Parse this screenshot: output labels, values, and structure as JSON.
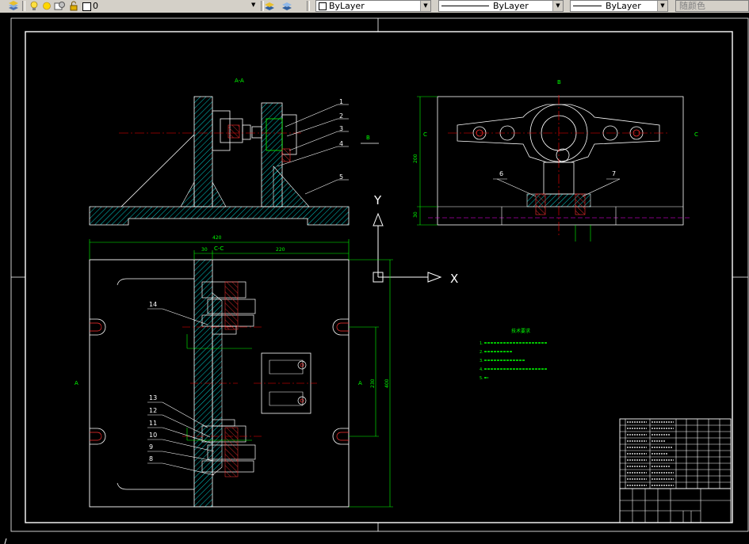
{
  "toolbar": {
    "layer_value": "0",
    "color_value": "ByLayer",
    "linetype_value": "ByLayer",
    "lineweight_value": "ByLayer",
    "plotstyle_value": "随颜色"
  },
  "drawing": {
    "view_aa": "A-A",
    "view_bb": "B",
    "view_cc": "C-C",
    "label_b_arrow": "B",
    "label_c_left": "C",
    "label_c_right": "C",
    "label_a_left": "A",
    "label_a_right": "A",
    "dim_420": "420",
    "dim_30": "30",
    "dim_220": "220",
    "dim_400": "400",
    "dim_230": "230",
    "dim_200": "200",
    "dim_30b": "30",
    "ucs_y": "Y",
    "ucs_x": "X",
    "balloons_top": [
      "1",
      "2",
      "3",
      "4",
      "5"
    ],
    "balloons_b": [
      "6",
      "7"
    ],
    "balloons_left": [
      "14",
      "13",
      "12",
      "11",
      "10",
      "9",
      "8"
    ],
    "tech_title": "技术要求",
    "tech_notes": [
      "1.",
      "2.",
      "3.",
      "4.",
      "5."
    ]
  },
  "colors": {
    "background": "#000000",
    "outline": "#ffffff",
    "center": "#ff0000",
    "hatch": "#00ffff",
    "dimension": "#00ff00",
    "hidden": "#ff00ff",
    "toolbar": "#d4d0c8"
  }
}
